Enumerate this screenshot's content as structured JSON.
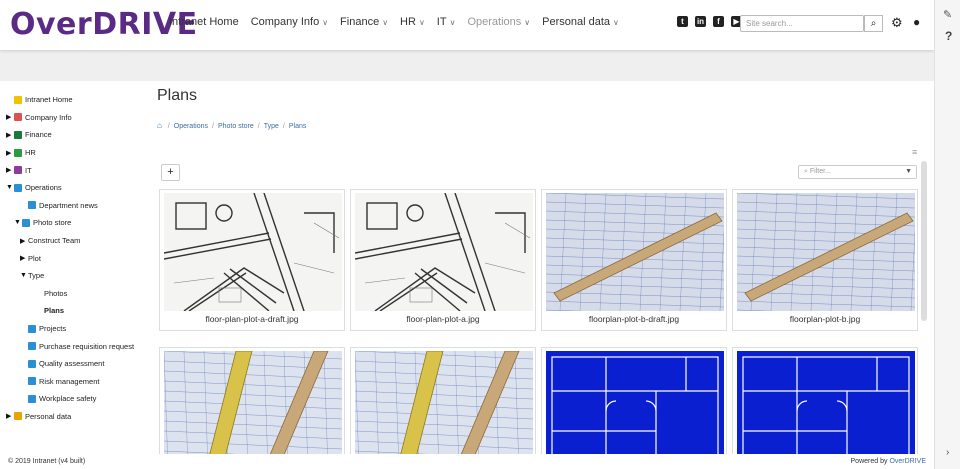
{
  "header": {
    "logo_prefix": "Over",
    "logo_suffix": "DRIVE",
    "nav": [
      {
        "label": "Intranet Home",
        "has_menu": false
      },
      {
        "label": "Company Info",
        "has_menu": true
      },
      {
        "label": "Finance",
        "has_menu": true
      },
      {
        "label": "HR",
        "has_menu": true
      },
      {
        "label": "IT",
        "has_menu": true
      },
      {
        "label": "Operations",
        "has_menu": true
      },
      {
        "label": "Personal data",
        "has_menu": true
      }
    ],
    "search_placeholder": "Site search...",
    "social_icons": [
      "twitter-icon",
      "linkedin-icon",
      "facebook-icon",
      "youtube-icon"
    ]
  },
  "sidebar": {
    "items": [
      {
        "label": "Intranet Home",
        "indent": 0,
        "tri": "",
        "icon_color": "#f2c200",
        "bold": false
      },
      {
        "label": "Company Info",
        "indent": 0,
        "tri": "▶",
        "icon_color": "#d9534f",
        "bold": false
      },
      {
        "label": "Finance",
        "indent": 0,
        "tri": "▶",
        "icon_color": "#1a7a3a",
        "bold": false
      },
      {
        "label": "HR",
        "indent": 0,
        "tri": "▶",
        "icon_color": "#2a9d3a",
        "bold": false
      },
      {
        "label": "IT",
        "indent": 0,
        "tri": "▶",
        "icon_color": "#8e3a9e",
        "bold": false
      },
      {
        "label": "Operations",
        "indent": 0,
        "tri": "▼",
        "icon_color": "#2b8fd6",
        "bold": false
      },
      {
        "label": "Department news",
        "indent": 14,
        "tri": "",
        "icon_color": "#2b8fd6",
        "bold": false
      },
      {
        "label": "Photo store",
        "indent": 8,
        "tri": "▼",
        "icon_color": "#2b8fd6",
        "bold": false
      },
      {
        "label": "Construct Team",
        "indent": 14,
        "tri": "▶",
        "icon_color": "",
        "bold": false
      },
      {
        "label": "Plot",
        "indent": 14,
        "tri": "▶",
        "icon_color": "",
        "bold": false
      },
      {
        "label": "Type",
        "indent": 14,
        "tri": "▼",
        "icon_color": "",
        "bold": false
      },
      {
        "label": "Photos",
        "indent": 30,
        "tri": "",
        "icon_color": "",
        "bold": false
      },
      {
        "label": "Plans",
        "indent": 30,
        "tri": "",
        "icon_color": "",
        "bold": true
      },
      {
        "label": "Projects",
        "indent": 14,
        "tri": "",
        "icon_color": "#2b8fd6",
        "bold": false
      },
      {
        "label": "Purchase requisition request",
        "indent": 14,
        "tri": "",
        "icon_color": "#2b8fd6",
        "bold": false
      },
      {
        "label": "Quality assessment",
        "indent": 14,
        "tri": "",
        "icon_color": "#2b8fd6",
        "bold": false
      },
      {
        "label": "Risk management",
        "indent": 14,
        "tri": "",
        "icon_color": "#2b8fd6",
        "bold": false
      },
      {
        "label": "Workplace safety",
        "indent": 14,
        "tri": "",
        "icon_color": "#2b8fd6",
        "bold": false
      },
      {
        "label": "Personal data",
        "indent": 0,
        "tri": "▶",
        "icon_color": "#e8a400",
        "bold": false
      }
    ]
  },
  "main": {
    "title": "Plans",
    "breadcrumb": [
      "Operations",
      "Photo store",
      "Type",
      "Plans"
    ],
    "add_label": "+",
    "filter_placeholder": "Filter...",
    "files": [
      {
        "name": "floor-plan-plot-a-draft.jpg",
        "kind": "sketch"
      },
      {
        "name": "floor-plan-plot-a.jpg",
        "kind": "sketch"
      },
      {
        "name": "floorplan-plot-b-draft.jpg",
        "kind": "ruler"
      },
      {
        "name": "floorplan-plot-b.jpg",
        "kind": "ruler"
      },
      {
        "name": "",
        "kind": "pencil"
      },
      {
        "name": "",
        "kind": "pencil"
      },
      {
        "name": "",
        "kind": "blueprint"
      },
      {
        "name": "",
        "kind": "blueprint"
      }
    ]
  },
  "footer": {
    "copyright": "© 2019 Intranet (v4 built)",
    "powered_prefix": "Powered by ",
    "powered_link": "OverDRIVE"
  },
  "colors": {
    "brand": "#5b2a86",
    "link": "#3a6ea5"
  }
}
